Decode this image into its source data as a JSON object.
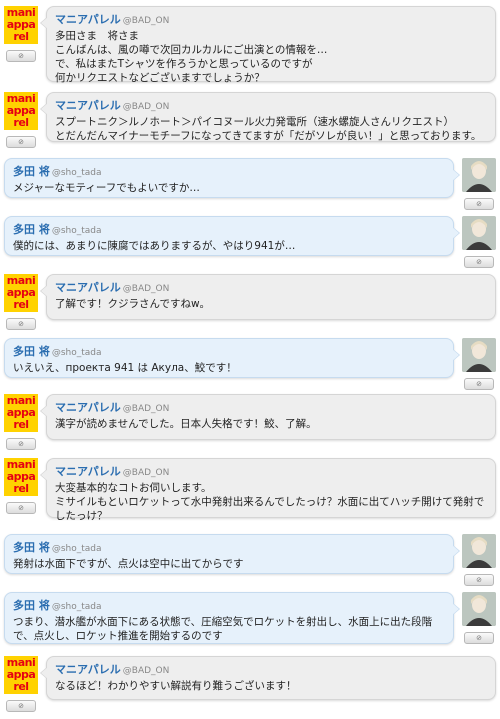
{
  "accounts": {
    "shop": {
      "name": "マニアパレル",
      "handle": "@BAD_ON",
      "logo_lines": [
        "mani",
        "appa",
        "rel"
      ]
    },
    "user": {
      "name": "多田 将",
      "handle": "@sho_tada"
    }
  },
  "messages": [
    {
      "text": "多田さま　将さま\nこんばんは、風の噂で次回カルカルにご出演との情報を…\nで、私はまたTシャツを作ろうかと思っているのですが\n何かリクエストなどございますでしょうか？"
    },
    {
      "text": "スプートニク＞ルノホート＞パイコヌール火力発電所（速水螺旋人さんリクエスト）\nとだんだんマイナーモチーフになってきてますが「だがソレが良い！」と思っております。"
    },
    {
      "text": "メジャーなモティーフでもよいですか…"
    },
    {
      "text": "僕的には、あまりに陳腐ではありまするが、やはり941が…"
    },
    {
      "text": "了解です！クジラさんですねw。"
    },
    {
      "text": "いえいえ、проекта 941 は Акула、鮫です！"
    },
    {
      "text": "漢字が読めませんでした。日本人失格です！鮫、了解。"
    },
    {
      "text": "大変基本的なコトお伺いします。\nミサイルもといロケットって水中発射出来るんでしたっけ？水面に出てハッチ開けて発射でしたっけ？"
    },
    {
      "text": "発射は水面下ですが、点火は空中に出てからです"
    },
    {
      "text": "つまり、潜水艦が水面下にある状態で、圧縮空気でロケットを射出し、水面上に出た段階で、点火し、ロケット推進を開始するのです"
    },
    {
      "text": "なるほど！わかりやすい解説有り難うございます！"
    }
  ]
}
